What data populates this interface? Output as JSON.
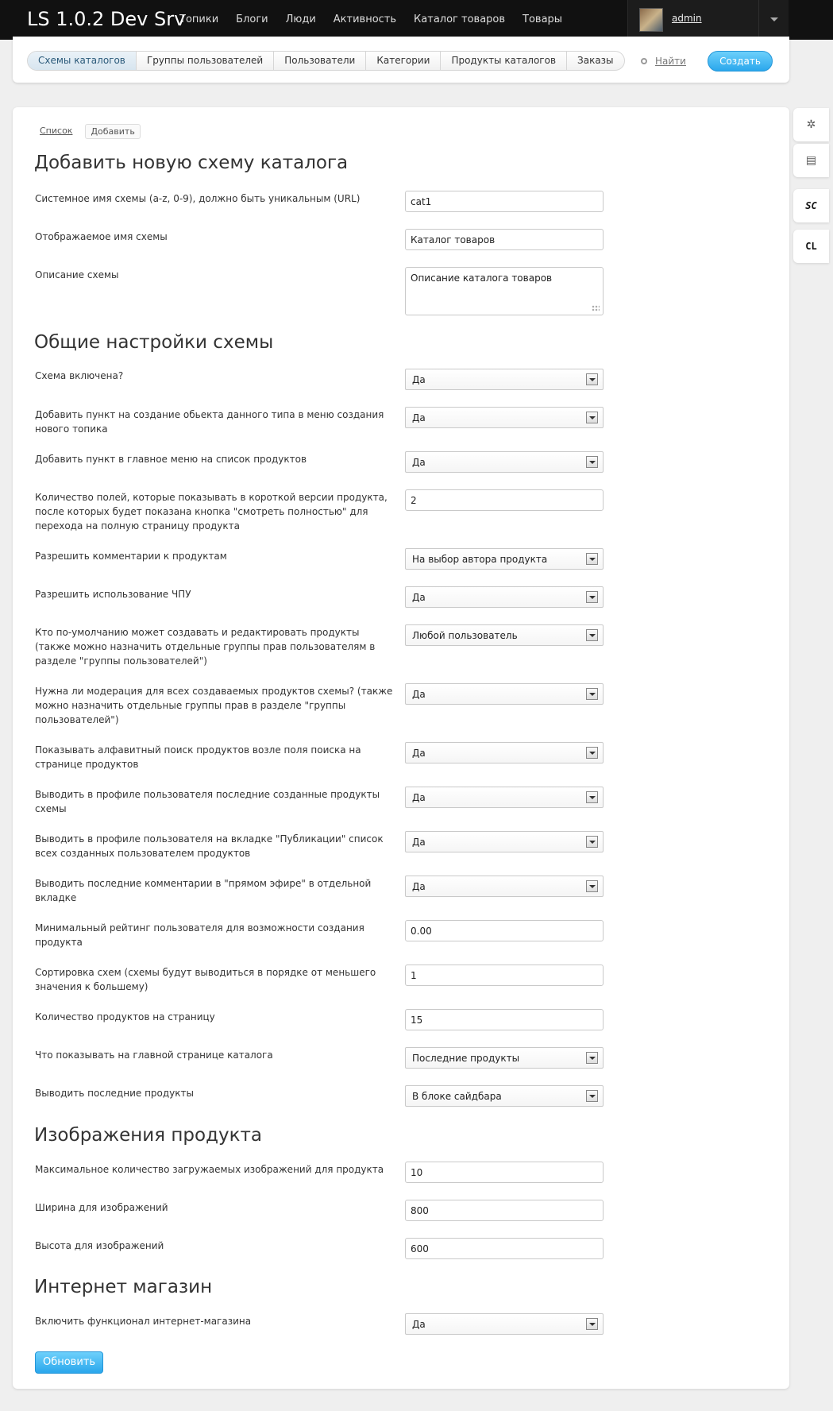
{
  "header": {
    "logo": "LS 1.0.2 Dev Srv",
    "nav": [
      "Топики",
      "Блоги",
      "Люди",
      "Активность",
      "Каталог товаров",
      "Товары"
    ],
    "username": "admin"
  },
  "subnav": {
    "pills": [
      "Схемы каталогов",
      "Группы пользователей",
      "Пользователи",
      "Категории",
      "Продукты каталогов",
      "Заказы"
    ],
    "search_label": "Найти",
    "create_label": "Создать"
  },
  "tabs": {
    "list": "Список",
    "add": "Добавить"
  },
  "form": {
    "title": "Добавить новую схему каталога",
    "sys_name_label": "Системное имя схемы (a-z, 0-9), должно быть уникальным (URL)",
    "sys_name_value": "cat1",
    "display_name_label": "Отображаемое имя схемы",
    "display_name_value": "Каталог товаров",
    "description_label": "Описание схемы",
    "description_value": "Описание каталога товаров",
    "general_title": "Общие настройки схемы",
    "enabled_label": "Схема включена?",
    "enabled_value": "Да",
    "menu_create_label": "Добавить пункт на создание обьекта данного типа в меню создания нового топика",
    "menu_create_value": "Да",
    "main_menu_label": "Добавить пункт в главное меню на список продуктов",
    "main_menu_value": "Да",
    "short_fields_label": "Количество полей, которые показывать в короткой версии продукта, после которых будет показана кнопка \"смотреть полностью\" для перехода на полную страницу продукта",
    "short_fields_value": "2",
    "comments_label": "Разрешить комментарии к продуктам",
    "comments_value": "На выбор автора продукта",
    "cpu_label": "Разрешить использование ЧПУ",
    "cpu_value": "Да",
    "who_can_label": "Кто по-умолчанию может создавать и редактировать продукты (также можно назначить отдельные группы прав пользователям в разделе \"группы пользователей\")",
    "who_can_value": "Любой пользователь",
    "moderation_label": "Нужна ли модерация для всех создаваемых продуктов схемы? (также можно назначить отдельные группы прав в разделе \"группы пользователей\")",
    "moderation_value": "Да",
    "alpha_label": "Показывать алфавитный поиск продуктов возле поля поиска на странице продуктов",
    "alpha_value": "Да",
    "profile_last_label": "Выводить в профиле пользователя последние созданные продукты схемы",
    "profile_last_value": "Да",
    "profile_pub_label": "Выводить в профиле пользователя на вкладке \"Публикации\" список всех созданных пользователем продуктов",
    "profile_pub_value": "Да",
    "live_label": "Выводить последние комментарии в \"прямом эфире\" в отдельной вкладке",
    "live_value": "Да",
    "rating_label": "Минимальный рейтинг пользователя для возможности создания продукта",
    "rating_value": "0.00",
    "sort_label": "Сортировка схем (схемы будут выводиться в порядке от меньшего значения к большему)",
    "sort_value": "1",
    "per_page_label": "Количество продуктов на страницу",
    "per_page_value": "15",
    "main_page_label": "Что показывать на главной странице каталога",
    "main_page_value": "Последние продукты",
    "last_products_label": "Выводить последние продукты",
    "last_products_value": "В блоке сайдбара",
    "images_title": "Изображения продукта",
    "max_images_label": "Максимальное количество загружаемых изображений для продукта",
    "max_images_value": "10",
    "img_width_label": "Ширина для изображений",
    "img_width_value": "800",
    "img_height_label": "Высота для изображений",
    "img_height_value": "600",
    "shop_title": "Интернет магазин",
    "shop_label": "Включить функционал интернет-магазина",
    "shop_value": "Да",
    "submit_label": "Обновить"
  },
  "side_widgets": {
    "sc": "SC",
    "cl": "CL"
  }
}
